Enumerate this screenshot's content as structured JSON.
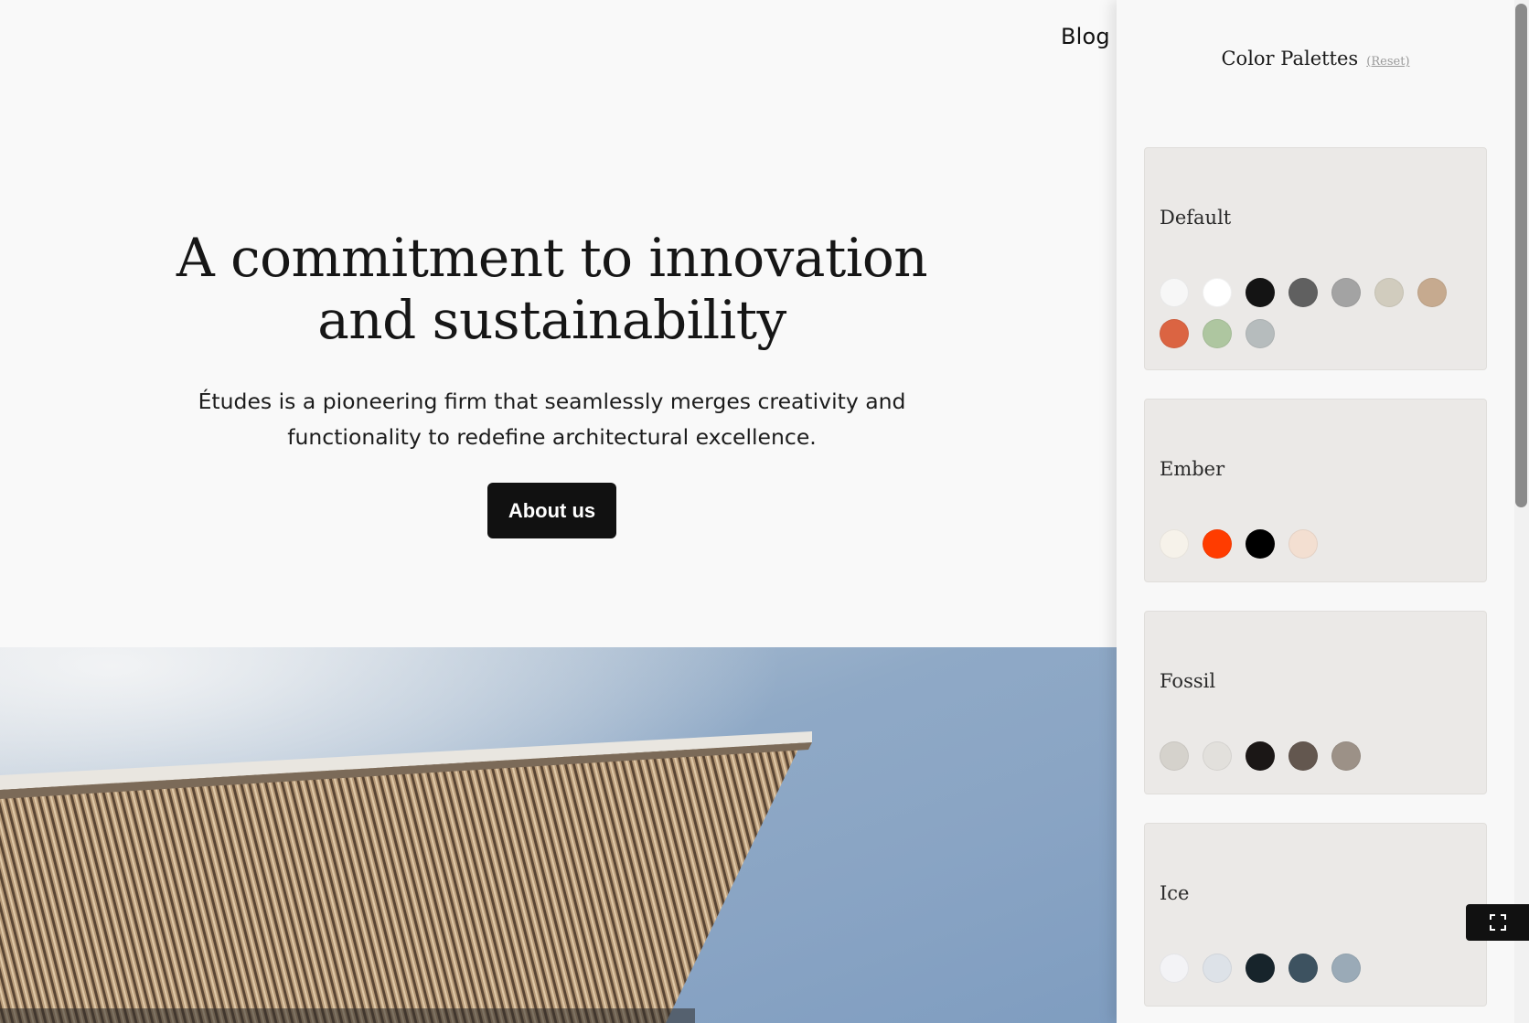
{
  "nav": {
    "blog_label": "Blog"
  },
  "hero": {
    "title_line1": "A commitment to innovation",
    "title_line2": "and sustainability",
    "desc_line1": "Études is a pioneering firm that seamlessly merges creativity and",
    "desc_line2": "functionality to redefine architectural excellence.",
    "button_label": "About us"
  },
  "panel": {
    "title": "Color Palettes",
    "reset_label": "(Reset)",
    "palettes": [
      {
        "name": "Default",
        "colors": [
          "#f7f7f7",
          "#ffffff",
          "#141414",
          "#606060",
          "#a3a3a3",
          "#d1ccbe",
          "#c6aa8f",
          "#db6442",
          "#aec6a0",
          "#b6bcbd"
        ]
      },
      {
        "name": "Ember",
        "colors": [
          "#f6f2ea",
          "#ff3c00",
          "#000000",
          "#f3dfd1"
        ]
      },
      {
        "name": "Fossil",
        "colors": [
          "#d5d2cc",
          "#e2e0dc",
          "#1b1716",
          "#63574f",
          "#9c9187"
        ]
      },
      {
        "name": "Ice",
        "colors": [
          "#f3f3f6",
          "#dde2e8",
          "#17242b",
          "#3d5260",
          "#9aaab7"
        ]
      }
    ]
  },
  "icons": {
    "fullscreen": "fullscreen-icon"
  }
}
